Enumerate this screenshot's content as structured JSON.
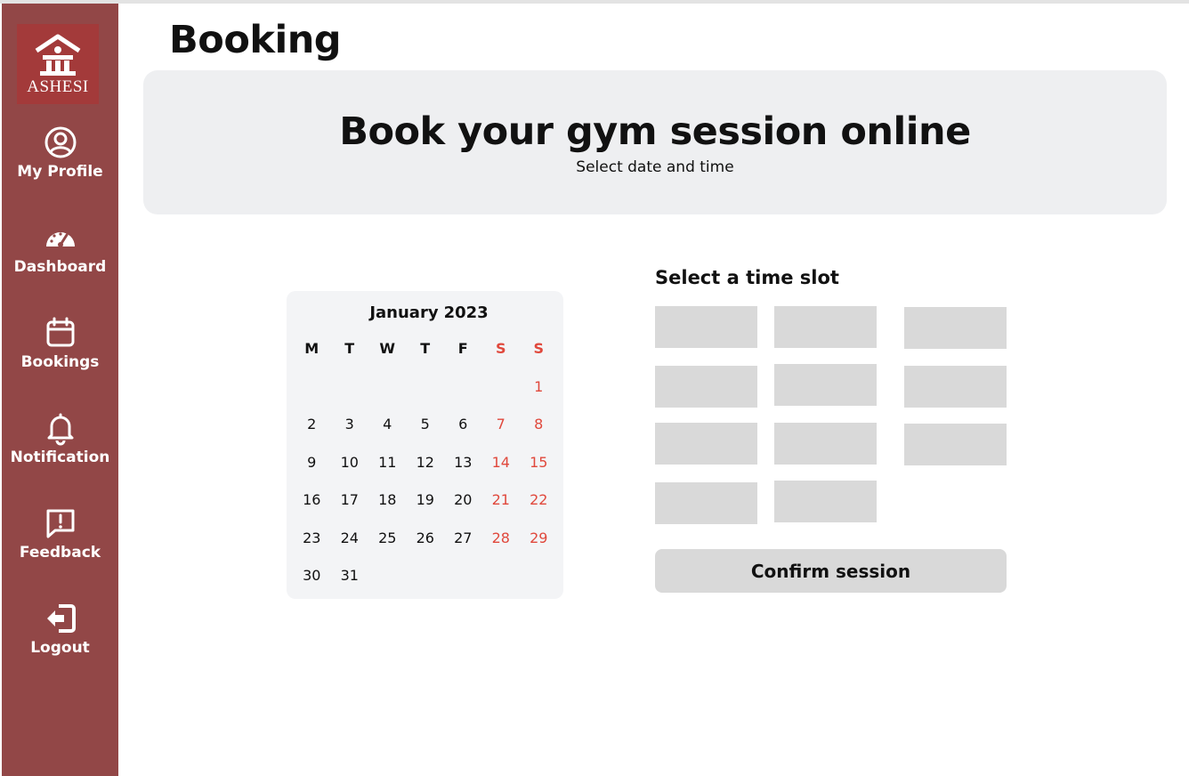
{
  "sidebar": {
    "logo_text": "ASHESI",
    "items": [
      {
        "label": "My Profile",
        "icon": "user-circle-icon"
      },
      {
        "label": "Dashboard",
        "icon": "gauge-icon"
      },
      {
        "label": "Bookings",
        "icon": "calendar-icon"
      },
      {
        "label": "Notification",
        "icon": "bell-icon"
      },
      {
        "label": "Feedback",
        "icon": "feedback-icon"
      },
      {
        "label": "Logout",
        "icon": "logout-icon"
      }
    ]
  },
  "header": {
    "title": "Booking"
  },
  "hero": {
    "title": "Book your gym session online",
    "subtitle": "Select date and time"
  },
  "calendar": {
    "month": "January",
    "year": "2023",
    "weekdays": [
      "M",
      "T",
      "W",
      "T",
      "F",
      "S",
      "S"
    ],
    "weeks": [
      [
        "",
        "",
        "",
        "",
        "",
        "",
        "1"
      ],
      [
        "2",
        "3",
        "4",
        "5",
        "6",
        "7",
        "8"
      ],
      [
        "9",
        "10",
        "11",
        "12",
        "13",
        "14",
        "15"
      ],
      [
        "16",
        "17",
        "18",
        "19",
        "20",
        "21",
        "22"
      ],
      [
        "23",
        "24",
        "25",
        "26",
        "27",
        "28",
        "29"
      ],
      [
        "30",
        "31",
        "",
        "",
        "",
        "",
        ""
      ]
    ]
  },
  "time_slots": {
    "title": "Select a time slot",
    "slot_count": 11
  },
  "confirm": {
    "label": "Confirm session"
  },
  "colors": {
    "sidebar": "#924747",
    "logo_bg": "#a33a3a",
    "weekend": "#e0483c",
    "panel": "#eeeff1",
    "slot": "#d9d9d9"
  }
}
